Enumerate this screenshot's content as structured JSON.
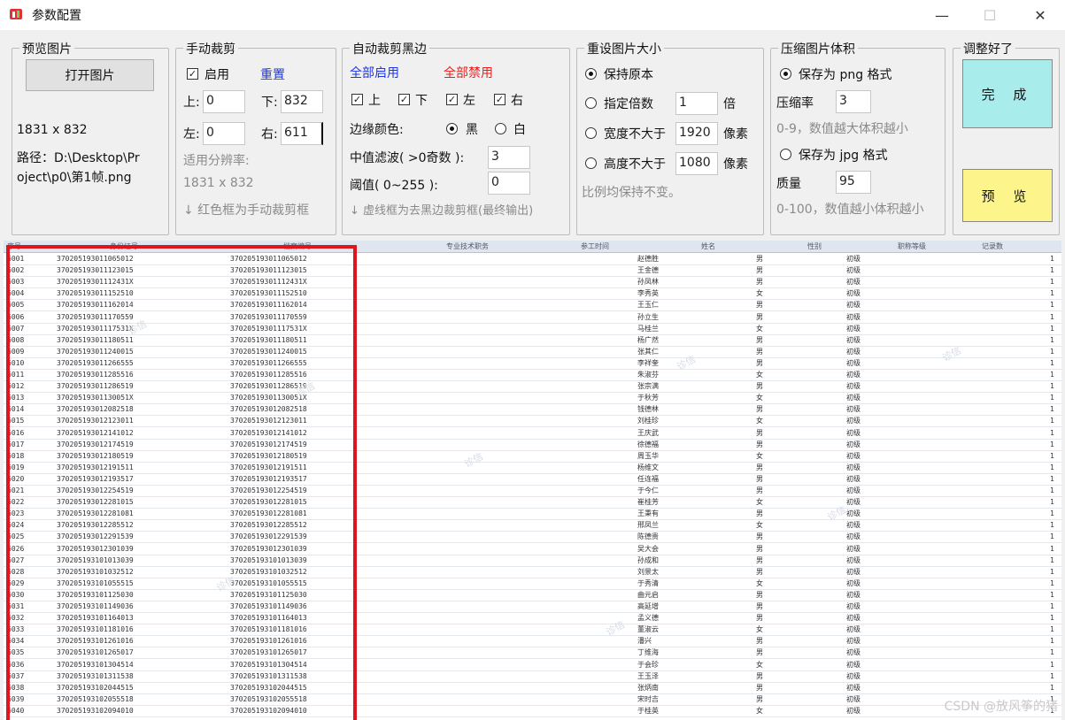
{
  "window": {
    "title": "参数配置",
    "minimize": "—",
    "maximize": "☐",
    "close": "✕"
  },
  "preview_group": {
    "legend": "预览图片",
    "open_button": "打开图片",
    "size": "1831 x 832",
    "path_line1": "路径：D:\\Desktop\\Pr",
    "path_line2": "oject\\p0\\第1帧.png"
  },
  "manual_crop": {
    "legend": "手动裁剪",
    "enable_label": "启用",
    "reset_link": "重置",
    "top_label": "上:",
    "top_value": "0",
    "bottom_label": "下:",
    "bottom_value": "832",
    "left_label": "左:",
    "left_value": "0",
    "right_label": "右:",
    "right_value": "611",
    "resolution_label": "适用分辨率:",
    "resolution_value": "1831 x 832",
    "hint": "↓ 红色框为手动裁剪框"
  },
  "auto_crop": {
    "legend": "自动裁剪黑边",
    "enable_all": "全部启用",
    "disable_all": "全部禁用",
    "top": "上",
    "bottom": "下",
    "left": "左",
    "right": "右",
    "edge_color_label": "边缘颜色:",
    "black": "黑",
    "white": "白",
    "median_label": "中值滤波( >0奇数 ):",
    "median_value": "3",
    "threshold_label": "阈值( 0~255 ):",
    "threshold_value": "0",
    "hint": "↓ 虚线框为去黑边裁剪框(最终输出)"
  },
  "resize": {
    "legend": "重设图片大小",
    "keep_original": "保持原本",
    "scale_label": "指定倍数",
    "scale_value": "1",
    "scale_unit": "倍",
    "max_width_label": "宽度不大于",
    "max_width_value": "1920",
    "width_unit": "像素",
    "max_height_label": "高度不大于",
    "max_height_value": "1080",
    "height_unit": "像素",
    "note": "比例均保持不变。"
  },
  "compress": {
    "legend": "压缩图片体积",
    "png_label": "保存为 png 格式",
    "ratio_label": "压缩率",
    "ratio_value": "3",
    "ratio_hint": "0-9，数值越大体积越小",
    "jpg_label": "保存为 jpg 格式",
    "quality_label": "质量",
    "quality_value": "95",
    "quality_hint": "0-100，数值越小体积越小"
  },
  "done_group": {
    "legend": "调整好了",
    "done_button": "完 成",
    "preview_button": "预 览"
  },
  "colors": {
    "done_bg": "#a8ecec",
    "preview_bg": "#fdf58b",
    "crop_border": "#e0141e",
    "accent_blue": "#1a36e8",
    "accent_red": "#ee1c1c"
  },
  "table": {
    "headers": [
      "序号",
      "身份证号",
      "档案编号",
      "专业技术职务",
      "参工时间",
      "姓名",
      "性别",
      "职称等级",
      "记录数"
    ],
    "rows": [
      {
        "id": "6001",
        "c1": "370205193011065012",
        "c2": "370205193011065012",
        "name": "赵德胜",
        "sex": "男"
      },
      {
        "id": "6002",
        "c1": "370205193011123015",
        "c2": "370205193011123015",
        "name": "王金德",
        "sex": "男"
      },
      {
        "id": "6003",
        "c1": "37020519301112431X",
        "c2": "37020519301112431X",
        "name": "孙凤林",
        "sex": "男"
      },
      {
        "id": "6004",
        "c1": "370205193011152510",
        "c2": "370205193011152510",
        "name": "李秀英",
        "sex": "女"
      },
      {
        "id": "6005",
        "c1": "370205193011162014",
        "c2": "370205193011162014",
        "name": "王玉仁",
        "sex": "男"
      },
      {
        "id": "6006",
        "c1": "370205193011170559",
        "c2": "370205193011170559",
        "name": "孙立生",
        "sex": "男"
      },
      {
        "id": "6007",
        "c1": "37020519301117531X",
        "c2": "37020519301117531X",
        "name": "马桂兰",
        "sex": "女"
      },
      {
        "id": "6008",
        "c1": "370205193011180511",
        "c2": "370205193011180511",
        "name": "杨广然",
        "sex": "男"
      },
      {
        "id": "6009",
        "c1": "370205193011240015",
        "c2": "370205193011240015",
        "name": "张其仁",
        "sex": "男"
      },
      {
        "id": "6010",
        "c1": "370205193011266555",
        "c2": "370205193011266555",
        "name": "李祥奎",
        "sex": "男"
      },
      {
        "id": "6011",
        "c1": "370205193011285516",
        "c2": "370205193011285516",
        "name": "朱淑芬",
        "sex": "女"
      },
      {
        "id": "6012",
        "c1": "370205193011286519",
        "c2": "370205193011286519",
        "name": "张宗满",
        "sex": "男"
      },
      {
        "id": "6013",
        "c1": "37020519301130051X",
        "c2": "37020519301130051X",
        "name": "于秋芳",
        "sex": "女"
      },
      {
        "id": "6014",
        "c1": "370205193012082518",
        "c2": "370205193012082518",
        "name": "钱德林",
        "sex": "男"
      },
      {
        "id": "6015",
        "c1": "370205193012123011",
        "c2": "370205193012123011",
        "name": "刘桂珍",
        "sex": "女"
      },
      {
        "id": "6016",
        "c1": "370205193012141012",
        "c2": "370205193012141012",
        "name": "王庆武",
        "sex": "男"
      },
      {
        "id": "6017",
        "c1": "370205193012174519",
        "c2": "370205193012174519",
        "name": "徐德福",
        "sex": "男"
      },
      {
        "id": "6018",
        "c1": "370205193012180519",
        "c2": "370205193012180519",
        "name": "周玉华",
        "sex": "女"
      },
      {
        "id": "6019",
        "c1": "370205193012191511",
        "c2": "370205193012191511",
        "name": "杨维文",
        "sex": "男"
      },
      {
        "id": "6020",
        "c1": "370205193012193517",
        "c2": "370205193012193517",
        "name": "任连福",
        "sex": "男"
      },
      {
        "id": "6021",
        "c1": "370205193012254519",
        "c2": "370205193012254519",
        "name": "于今仁",
        "sex": "男"
      },
      {
        "id": "6022",
        "c1": "370205193012281015",
        "c2": "370205193012281015",
        "name": "崔桂芳",
        "sex": "女"
      },
      {
        "id": "6023",
        "c1": "370205193012281081",
        "c2": "370205193012281081",
        "name": "王秉有",
        "sex": "男"
      },
      {
        "id": "6024",
        "c1": "370205193012285512",
        "c2": "370205193012285512",
        "name": "邢凤兰",
        "sex": "女"
      },
      {
        "id": "6025",
        "c1": "370205193012291539",
        "c2": "370205193012291539",
        "name": "陈德贵",
        "sex": "男"
      },
      {
        "id": "6026",
        "c1": "370205193012301039",
        "c2": "370205193012301039",
        "name": "吴大会",
        "sex": "男"
      },
      {
        "id": "6027",
        "c1": "370205193101013039",
        "c2": "370205193101013039",
        "name": "孙成和",
        "sex": "男"
      },
      {
        "id": "6028",
        "c1": "370205193101032512",
        "c2": "370205193101032512",
        "name": "刘景太",
        "sex": "男"
      },
      {
        "id": "6029",
        "c1": "370205193101055515",
        "c2": "370205193101055515",
        "name": "于秀清",
        "sex": "女"
      },
      {
        "id": "6030",
        "c1": "370205193101125030",
        "c2": "370205193101125030",
        "name": "曲元启",
        "sex": "男"
      },
      {
        "id": "6031",
        "c1": "370205193101149036",
        "c2": "370205193101149036",
        "name": "高延增",
        "sex": "男"
      },
      {
        "id": "6032",
        "c1": "370205193101164013",
        "c2": "370205193101164013",
        "name": "孟义德",
        "sex": "男"
      },
      {
        "id": "6033",
        "c1": "370205193101181016",
        "c2": "370205193101181016",
        "name": "董淑云",
        "sex": "女"
      },
      {
        "id": "6034",
        "c1": "370205193101261016",
        "c2": "370205193101261016",
        "name": "潘兴",
        "sex": "男"
      },
      {
        "id": "6035",
        "c1": "370205193101265017",
        "c2": "370205193101265017",
        "name": "丁维海",
        "sex": "男"
      },
      {
        "id": "6036",
        "c1": "370205193101304514",
        "c2": "370205193101304514",
        "name": "于会珍",
        "sex": "女"
      },
      {
        "id": "6037",
        "c1": "370205193101311538",
        "c2": "370205193101311538",
        "name": "王玉泽",
        "sex": "男"
      },
      {
        "id": "6038",
        "c1": "370205193102044515",
        "c2": "370205193102044515",
        "name": "张炳南",
        "sex": "男"
      },
      {
        "id": "6039",
        "c1": "370205193102055518",
        "c2": "370205193102055518",
        "name": "宋时吉",
        "sex": "男"
      },
      {
        "id": "6040",
        "c1": "370205193102094010",
        "c2": "370205193102094010",
        "name": "于桂英",
        "sex": "女"
      }
    ],
    "level": "初级",
    "count": "1"
  },
  "watermark": "CSDN @放风筝的猪"
}
